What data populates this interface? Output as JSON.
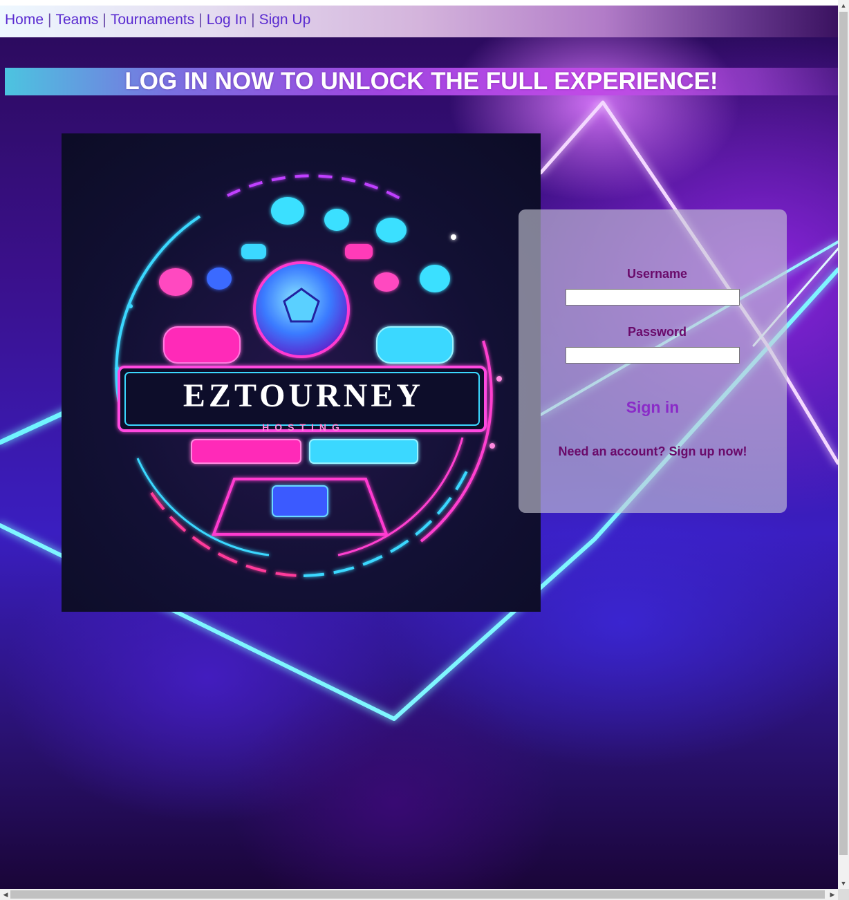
{
  "nav": {
    "items": [
      "Home",
      "Teams",
      "Tournaments",
      "Log In",
      "Sign Up"
    ],
    "separator": "|"
  },
  "banner": {
    "text": "LOG IN NOW TO UNLOCK THE FULL EXPERIENCE!"
  },
  "logo": {
    "brand": "EZTOURNEY",
    "sub": "HOSTING"
  },
  "login": {
    "username_label": "Username",
    "username_value": "",
    "password_label": "Password",
    "password_value": "",
    "signin_label": "Sign in",
    "signup_prompt": "Need an account?",
    "signup_link": "Sign up now!"
  },
  "colors": {
    "accent": "#8a2bc8",
    "label": "#6a0a6a",
    "nav_link": "#5a2bd0",
    "neon_cyan": "#4ff0ff",
    "neon_pink": "#ff3dd0"
  }
}
